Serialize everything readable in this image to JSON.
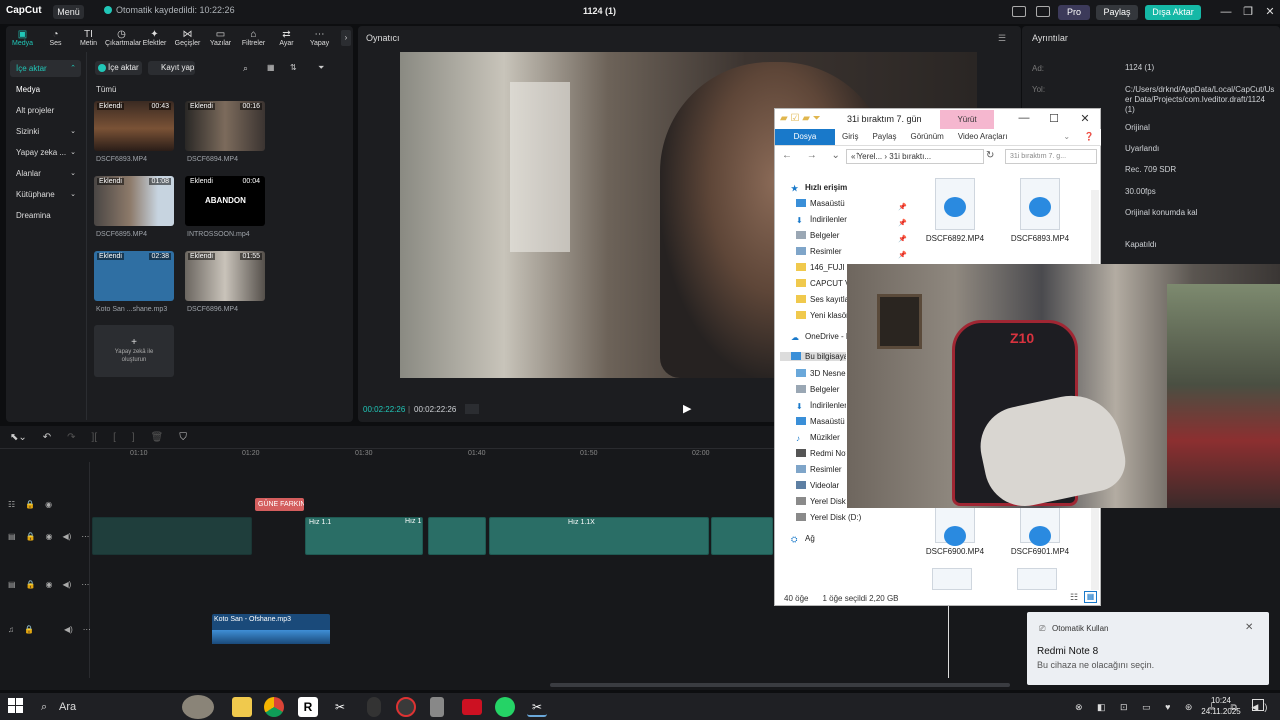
{
  "app": {
    "logo": "CapCut",
    "menu": "Menü",
    "autosave": "Otomatik kaydedildi: 10:22:26",
    "project_title": "1124 (1)",
    "pro": "Pro",
    "share": "Paylaş",
    "export": "Dışa Aktar"
  },
  "tool_tabs": [
    {
      "label": "Medya",
      "icon": "media-icon"
    },
    {
      "label": "Ses",
      "icon": "audio-icon"
    },
    {
      "label": "Metin",
      "icon": "text-icon"
    },
    {
      "label": "Çıkartmalar",
      "icon": "sticker-icon"
    },
    {
      "label": "Efektler",
      "icon": "effects-icon"
    },
    {
      "label": "Geçişler",
      "icon": "transition-icon"
    },
    {
      "label": "Yazılar",
      "icon": "captions-icon"
    },
    {
      "label": "Filtreler",
      "icon": "filter-icon"
    },
    {
      "label": "Ayar",
      "icon": "adjust-icon"
    },
    {
      "label": "Yapay",
      "icon": "ai-icon"
    }
  ],
  "side_nav": [
    {
      "label": "İçe aktar",
      "state": "highlight"
    },
    {
      "label": "Medya",
      "state": "active"
    },
    {
      "label": "Alt projeler",
      "state": ""
    },
    {
      "label": "Sizinki",
      "state": "",
      "arrow": "⌄"
    },
    {
      "label": "Yapay zeka ...",
      "state": "",
      "arrow": "⌄"
    },
    {
      "label": "Alanlar",
      "state": "",
      "arrow": "⌄"
    },
    {
      "label": "Kütüphane",
      "state": "",
      "arrow": "⌄"
    },
    {
      "label": "Dreamina",
      "state": "",
      "arrow": ""
    }
  ],
  "media": {
    "import": "İçe aktar",
    "record": "Kayıt yap",
    "filter_all": "Tümü",
    "items": [
      {
        "tag": "Eklendi",
        "dur": "00:43",
        "name": "DSCF6893.MP4"
      },
      {
        "tag": "Eklendi",
        "dur": "00:16",
        "name": "DSCF6894.MP4"
      },
      {
        "tag": "Eklendi",
        "dur": "01:08",
        "name": "DSCF6895.MP4"
      },
      {
        "tag": "Eklendi",
        "dur": "00:04",
        "name": "INTROSSOON.mp4",
        "overlay": "ABANDON"
      },
      {
        "tag": "Eklendi",
        "dur": "02:38",
        "name": "Koto San ...shane.mp3"
      },
      {
        "tag": "Eklendi",
        "dur": "01:55",
        "name": "DSCF6896.MP4"
      }
    ],
    "ai_create": "Yapay zekâ ile oluşturun"
  },
  "player": {
    "title": "Oynatıcı",
    "current": "00:02:22:26",
    "total": "00:02:22:26"
  },
  "details": {
    "title": "Ayrıntılar",
    "rows": [
      {
        "label": "Ad:",
        "value": "1124 (1)"
      },
      {
        "label": "Yol:",
        "value": "C:/Users/drknd/AppData/Local/CapCut/User Data/Projects/com.lveditor.draft/1124 (1)"
      },
      {
        "label": "",
        "value": "Orijinal"
      },
      {
        "label": "",
        "value": "Uyarlandı"
      },
      {
        "label": "",
        "value": "Rec. 709 SDR"
      },
      {
        "label": "",
        "value": "30.00fps"
      },
      {
        "label": "",
        "value": "Orijinal konumda kal"
      },
      {
        "label": "",
        "value": "Kapatıldı"
      }
    ]
  },
  "timeline": {
    "ticks": [
      "01:10",
      "01:20",
      "01:30",
      "01:40",
      "01:50",
      "02:00"
    ],
    "tag": "GÜNE FARKIN",
    "clip_labels": [
      "Hız 1.1",
      "Hız 1",
      "Hız 1.1X"
    ],
    "audio_clip": "Koto San - Ofshane.mp3"
  },
  "explorer": {
    "title": "31i bıraktım 7. gün",
    "yurut": "Yürüt",
    "ribbon": [
      "Dosya",
      "Giriş",
      "Paylaş",
      "Görünüm",
      "Video Araçları"
    ],
    "address": "«  Yerel...  ›  31i bıraktı...",
    "search": "31i bıraktım 7. g...",
    "nav": [
      "Hızlı erişim",
      "Masaüstü",
      "İndirilenler",
      "Belgeler",
      "Resimler",
      "146_FUJI",
      "CAPCUT V",
      "Ses kayıtla",
      "Yeni klasör",
      "OneDrive - P",
      "Bu bilgisaya",
      "3D Nesnel",
      "Belgeler",
      "İndirilenler",
      "Masaüstü",
      "Müzikler",
      "Redmi Not",
      "Resimler",
      "Videolar",
      "Yerel Disk (",
      "Yerel Disk (D:)",
      "Ağ"
    ],
    "files": [
      "DSCF6892.MP4",
      "DSCF6893.MP4",
      "DSCF6900.MP4",
      "DSCF6901.MP4"
    ],
    "status_count": "40 öğe",
    "status_selected": "1 öğe seçildi  2,20 GB"
  },
  "webcam": {
    "logo": "Z10"
  },
  "notification": {
    "app": "Otomatik Kullan",
    "title": "Redmi Note 8",
    "body": "Bu cihaza ne olacağını seçin."
  },
  "taskbar": {
    "search": "Ara",
    "time": "10:24",
    "date": "24.11.2025"
  }
}
